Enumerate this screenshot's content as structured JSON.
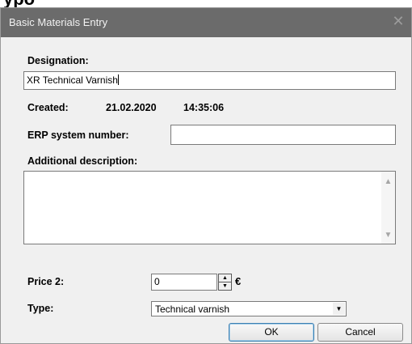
{
  "top_fragment": "ypo",
  "window": {
    "title": "Basic Materials Entry",
    "close_glyph": "✕"
  },
  "form": {
    "designation_label": "Designation:",
    "designation_value": "XR Technical Varnish",
    "created_label": "Created:",
    "created_date": "21.02.2020",
    "created_time": "14:35:06",
    "erp_label": "ERP system number:",
    "erp_value": "",
    "additional_label": "Additional description:",
    "additional_value": "",
    "price_label": "Price 2:",
    "price_value": "0",
    "currency": "€",
    "type_label": "Type:",
    "type_value": "Technical varnish"
  },
  "buttons": {
    "ok": "OK",
    "cancel": "Cancel"
  },
  "icons": {
    "spin_up": "▲",
    "spin_down": "▼",
    "scroll_up": "▲",
    "scroll_down": "▼",
    "dropdown": "▼"
  }
}
